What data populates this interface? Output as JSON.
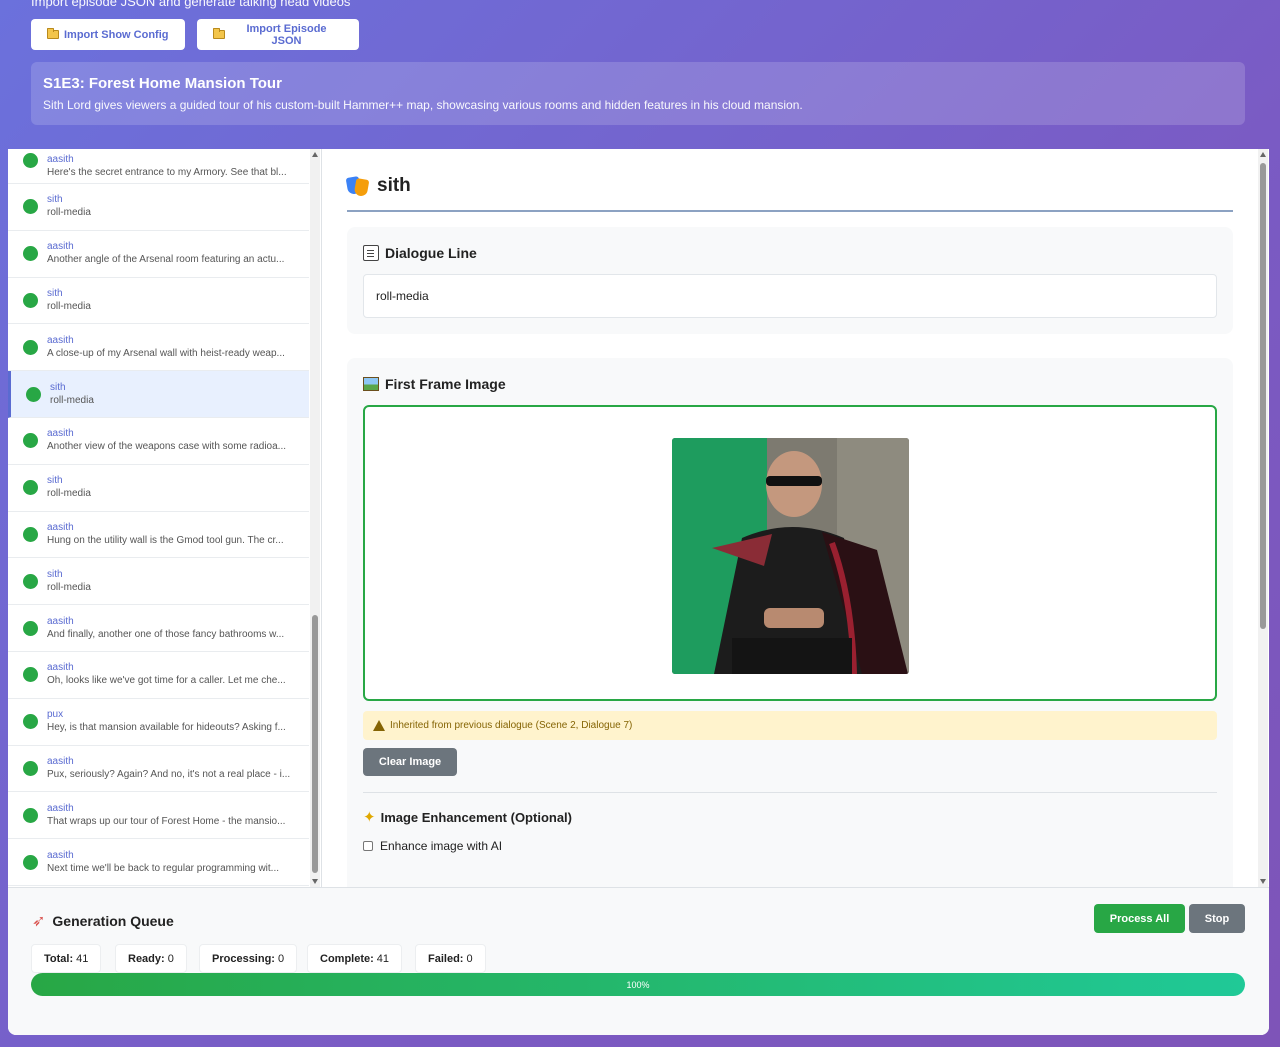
{
  "header": {
    "subtitle": "Import episode JSON and generate talking head videos",
    "import_show_label": "Import Show Config",
    "import_episode_label": "Import Episode JSON",
    "episode_title": "S1E3: Forest Home Mansion Tour",
    "episode_description": "Sith Lord gives viewers a guided tour of his custom-built Hammer++ map, showcasing various rooms and hidden features in his cloud mansion."
  },
  "sidebar": {
    "items": [
      {
        "speaker": "aasith",
        "line": "Here's the secret entrance to my Armory. See that bl...",
        "status": "complete"
      },
      {
        "speaker": "sith",
        "line": "roll-media",
        "status": "complete"
      },
      {
        "speaker": "aasith",
        "line": "Another angle of the Arsenal room featuring an actu...",
        "status": "complete"
      },
      {
        "speaker": "sith",
        "line": "roll-media",
        "status": "complete"
      },
      {
        "speaker": "aasith",
        "line": "A close-up of my Arsenal wall with heist-ready weap...",
        "status": "complete"
      },
      {
        "speaker": "sith",
        "line": "roll-media",
        "status": "complete",
        "selected": true
      },
      {
        "speaker": "aasith",
        "line": "Another view of the weapons case with some radioa...",
        "status": "complete"
      },
      {
        "speaker": "sith",
        "line": "roll-media",
        "status": "complete"
      },
      {
        "speaker": "aasith",
        "line": "Hung on the utility wall is the Gmod tool gun. The cr...",
        "status": "complete"
      },
      {
        "speaker": "sith",
        "line": "roll-media",
        "status": "complete"
      },
      {
        "speaker": "aasith",
        "line": "And finally, another one of those fancy bathrooms w...",
        "status": "complete"
      },
      {
        "speaker": "aasith",
        "line": "Oh, looks like we've got time for a caller. Let me che...",
        "status": "complete"
      },
      {
        "speaker": "pux",
        "line": "Hey, is that mansion available for hideouts? Asking f...",
        "status": "complete"
      },
      {
        "speaker": "aasith",
        "line": "Pux, seriously? Again? And no, it's not a real place - i...",
        "status": "complete"
      },
      {
        "speaker": "aasith",
        "line": "That wraps up our tour of Forest Home - the mansio...",
        "status": "complete"
      },
      {
        "speaker": "aasith",
        "line": "Next time we'll be back to regular programming wit...",
        "status": "complete"
      }
    ]
  },
  "detail": {
    "character_name": "sith",
    "dialogue_title": "Dialogue Line",
    "dialogue_value": "roll-media",
    "image_title": "First Frame Image",
    "inherited_notice": "Inherited from previous dialogue (Scene 2, Dialogue 7)",
    "clear_image_label": "Clear Image",
    "enhancement_title": "Image Enhancement (Optional)",
    "enhance_checkbox_label": "Enhance image with AI"
  },
  "queue": {
    "title": "Generation Queue",
    "process_all_label": "Process All",
    "stop_label": "Stop",
    "stats": [
      {
        "label": "Total:",
        "value": "41"
      },
      {
        "label": "Ready:",
        "value": "0"
      },
      {
        "label": "Processing:",
        "value": "0"
      },
      {
        "label": "Complete:",
        "value": "41"
      },
      {
        "label": "Failed:",
        "value": "0"
      }
    ],
    "progress_percent": 100,
    "progress_label": "100%"
  },
  "colors": {
    "accent": "#5a6bd1",
    "success": "#28a745",
    "secondary": "#6c757d",
    "warning_bg": "#fff3cd"
  }
}
